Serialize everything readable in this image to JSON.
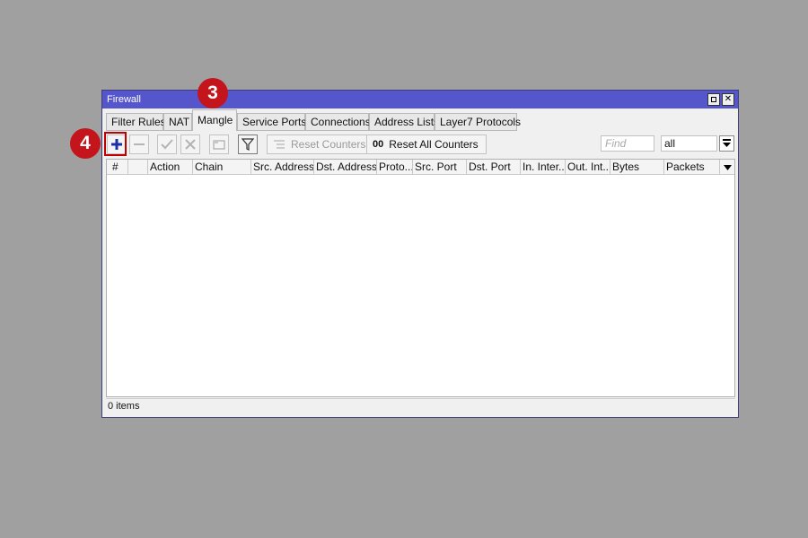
{
  "window": {
    "title": "Firewall"
  },
  "tabs": [
    {
      "label": "Filter Rules",
      "active": false
    },
    {
      "label": "NAT",
      "active": false
    },
    {
      "label": "Mangle",
      "active": true
    },
    {
      "label": "Service Ports",
      "active": false
    },
    {
      "label": "Connections",
      "active": false
    },
    {
      "label": "Address Lists",
      "active": false
    },
    {
      "label": "Layer7 Protocols",
      "active": false
    }
  ],
  "toolbar": {
    "add_icon": "plus-icon",
    "remove_icon": "minus-icon",
    "enable_icon": "check-icon",
    "disable_icon": "cross-icon",
    "comment_icon": "comment-icon",
    "filter_icon": "funnel-icon",
    "reset_counters_label": "Reset Counters",
    "reset_all_counters_label": "Reset All Counters",
    "reset_all_prefix": "00",
    "find_placeholder": "Find",
    "filter_select_value": "all"
  },
  "table": {
    "columns": [
      "#",
      "",
      "Action",
      "Chain",
      "Src. Address",
      "Dst. Address",
      "Proto...",
      "Src. Port",
      "Dst. Port",
      "In. Inter...",
      "Out. Int...",
      "Bytes",
      "Packets"
    ],
    "rows": []
  },
  "status": {
    "items_text": "0 items"
  },
  "annotations": [
    {
      "number": "3",
      "color": "#c4141c"
    },
    {
      "number": "4",
      "color": "#c4141c"
    }
  ],
  "colors": {
    "titlebar": "#5555cc",
    "highlight": "#c00000",
    "add_icon": "#1a2fa8"
  }
}
